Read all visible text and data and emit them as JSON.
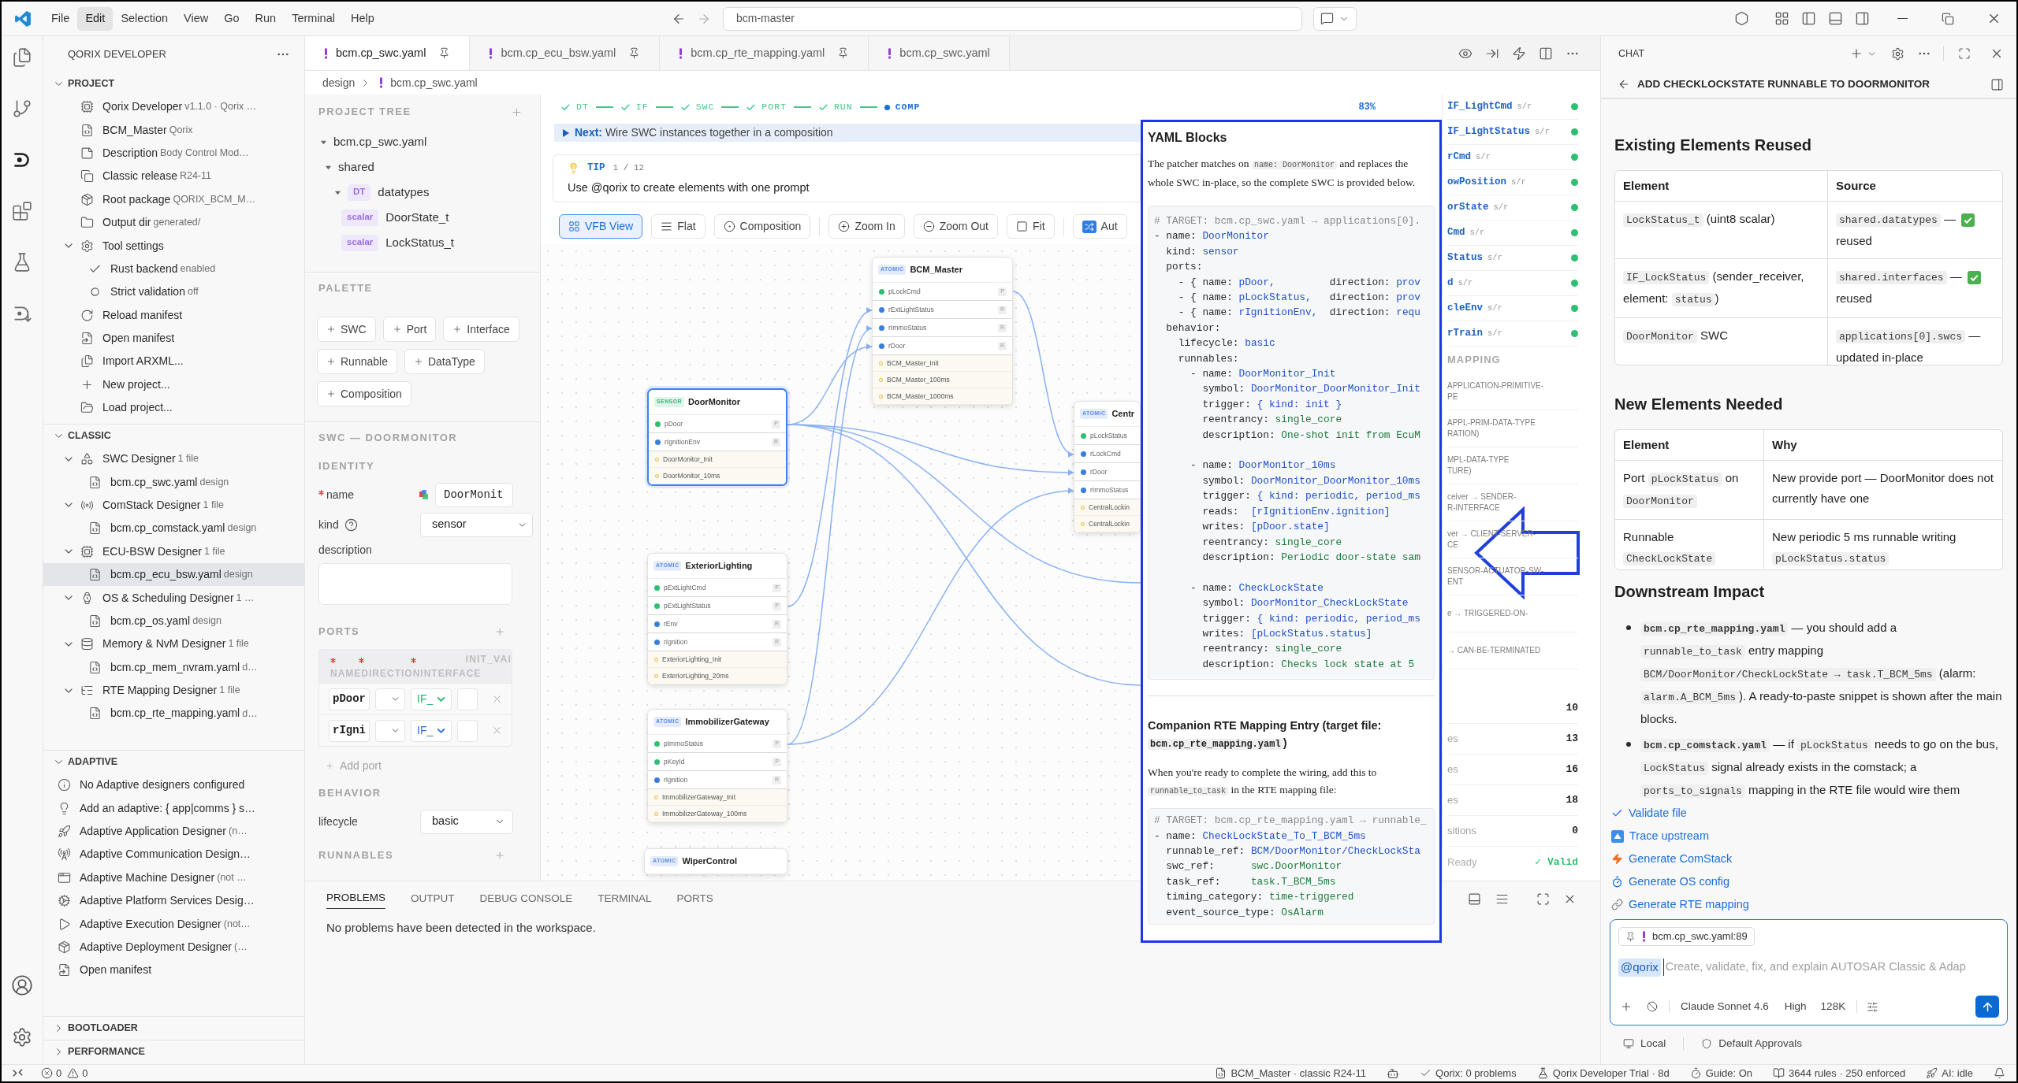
{
  "title_bar": {
    "menu": [
      {
        "label": "File",
        "selected": false
      },
      {
        "label": "Edit",
        "selected": true
      },
      {
        "label": "Selection",
        "selected": false
      },
      {
        "label": "View",
        "selected": false
      },
      {
        "label": "Go",
        "selected": false
      },
      {
        "label": "Run",
        "selected": false
      },
      {
        "label": "Terminal",
        "selected": false
      },
      {
        "label": "Help",
        "selected": false
      }
    ],
    "command_center": "bcm-master"
  },
  "activity_bar": [
    {
      "selected": false
    },
    {
      "selected": false
    },
    {
      "selected": true
    },
    {
      "selected": false
    },
    {
      "selected": false
    },
    {
      "selected": false
    }
  ],
  "sidebar": {
    "title": "QORIX DEVELOPER",
    "sections": [
      {
        "title": "PROJECT",
        "expanded": true,
        "items": [
          {
            "label": "Qorix Developer",
            "detail": "v1.1.0 · Qorix …",
            "selected": false
          },
          {
            "label": "BCM_Master",
            "detail": "Qorix",
            "selected": false
          },
          {
            "label": "Description",
            "detail": "Body Control Mod…",
            "selected": false
          },
          {
            "label": "Classic release",
            "detail": "R24-11",
            "selected": false
          },
          {
            "label": "Root package",
            "detail": "QORIX_BCM_M…",
            "selected": false
          },
          {
            "label": "Output dir",
            "detail": "generated/",
            "selected": false
          },
          {
            "label": "Tool settings",
            "selected": false,
            "expanded": true,
            "children": [
              {
                "label": "Rust backend",
                "detail": "enabled",
                "checked": true,
                "selected": false
              },
              {
                "label": "Strict validation",
                "detail": "off",
                "checked": false,
                "selected": false
              }
            ]
          },
          {
            "label": "Reload manifest",
            "selected": false
          },
          {
            "label": "Open manifest",
            "selected": false
          },
          {
            "label": "Import ARXML...",
            "selected": false
          },
          {
            "label": "New project...",
            "selected": false
          },
          {
            "label": "Load project...",
            "selected": false
          }
        ]
      },
      {
        "title": "CLASSIC",
        "expanded": true,
        "items": [
          {
            "label": "SWC Designer",
            "detail": "1 file",
            "selected": false,
            "expanded": true,
            "children": [
              {
                "label": "bcm.cp_swc.yaml",
                "detail": "design",
                "selected": false
              }
            ]
          },
          {
            "label": "ComStack Designer",
            "detail": "1 file",
            "selected": false,
            "expanded": true,
            "children": [
              {
                "label": "bcm.cp_comstack.yaml",
                "detail": "design",
                "selected": false
              }
            ]
          },
          {
            "label": "ECU-BSW Designer",
            "detail": "1 file",
            "selected": false,
            "expanded": true,
            "children": [
              {
                "label": "bcm.cp_ecu_bsw.yaml",
                "detail": "design",
                "selected": true
              }
            ]
          },
          {
            "label": "OS & Scheduling Designer",
            "detail": "1 …",
            "selected": false,
            "expanded": true,
            "children": [
              {
                "label": "bcm.cp_os.yaml",
                "detail": "design",
                "selected": false
              }
            ]
          },
          {
            "label": "Memory & NvM Designer",
            "detail": "1 file",
            "selected": false,
            "expanded": true,
            "children": [
              {
                "label": "bcm.cp_mem_nvram.yaml",
                "detail": "d…",
                "selected": false
              }
            ]
          },
          {
            "label": "RTE Mapping Designer",
            "detail": "1 file",
            "selected": false,
            "expanded": true,
            "children": [
              {
                "label": "bcm.cp_rte_mapping.yaml",
                "detail": "d…",
                "selected": false
              }
            ]
          }
        ]
      },
      {
        "title": "ADAPTIVE",
        "expanded": true,
        "items": [
          {
            "label": "No Adaptive designers configured",
            "selected": false
          },
          {
            "label": "Add an adaptive: { app|comms } s…",
            "selected": false
          },
          {
            "label": "Adaptive Application Designer",
            "detail": "(n…",
            "selected": false
          },
          {
            "label": "Adaptive Communication Design…",
            "selected": false
          },
          {
            "label": "Adaptive Machine Designer",
            "detail": "(not …",
            "selected": false
          },
          {
            "label": "Adaptive Platform Services Desig…",
            "selected": false
          },
          {
            "label": "Adaptive Execution Designer",
            "detail": "(not…",
            "selected": false
          },
          {
            "label": "Adaptive Deployment Designer",
            "detail": "(…",
            "selected": false
          },
          {
            "label": "Open manifest",
            "selected": false
          }
        ]
      },
      {
        "title": "BOOTLOADER",
        "expanded": false
      },
      {
        "title": "PERFORMANCE",
        "expanded": false
      }
    ]
  },
  "editor": {
    "tabs": [
      {
        "label": "bcm.cp_swc.yaml",
        "selected": true,
        "pinned": true
      },
      {
        "label": "bcm.cp_ecu_bsw.yaml",
        "selected": false,
        "pinned": true
      },
      {
        "label": "bcm.cp_rte_mapping.yaml",
        "selected": false,
        "pinned": true
      },
      {
        "label": "bcm.cp_swc.yaml",
        "selected": false,
        "pinned": false
      }
    ],
    "breadcrumb": [
      "design",
      "bcm.cp_swc.yaml"
    ]
  },
  "project_tree": {
    "title": "PROJECT TREE",
    "items": [
      {
        "label": "bcm.cp_swc.yaml",
        "expanded": true,
        "children": [
          {
            "label": "shared",
            "expanded": true,
            "children": [
              {
                "tag": "DT",
                "label": "datatypes",
                "expanded": true,
                "children": [
                  {
                    "tag": "scalar",
                    "label": "DoorState_t"
                  },
                  {
                    "tag": "scalar",
                    "label": "LockStatus_t"
                  }
                ]
              }
            ]
          }
        ]
      }
    ]
  },
  "palette": {
    "title": "PALETTE",
    "buttons": [
      "SWC",
      "Port",
      "Interface",
      "Runnable",
      "DataType",
      "Composition"
    ]
  },
  "swc_editor": {
    "title": "SWC — DOORMONITOR",
    "identity": {
      "title": "IDENTITY",
      "name": {
        "label": "name",
        "value": "DoorMonit",
        "required": true
      },
      "kind": {
        "label": "kind",
        "value": "sensor"
      },
      "description": {
        "label": "description"
      }
    },
    "ports": {
      "title": "PORTS",
      "header": "NAMEDIRECTIONINTERFACE",
      "extra_column": "INIT_VAI",
      "rows": [
        {
          "name": "pDoor",
          "interface": "IF_",
          "color": "#22b573"
        },
        {
          "name": "rIgni",
          "interface": "IF_",
          "color": "#2f6fe0"
        }
      ],
      "add": "Add port"
    },
    "behavior": {
      "title": "BEHAVIOR",
      "lifecycle": {
        "label": "lifecycle",
        "value": "basic"
      }
    },
    "runnables": {
      "title": "RUNNABLES"
    }
  },
  "canvas": {
    "steps": [
      {
        "label": "DT",
        "done": true
      },
      {
        "label": "IF",
        "done": true
      },
      {
        "label": "SWC",
        "done": true
      },
      {
        "label": "PORT",
        "done": true
      },
      {
        "label": "RUN",
        "done": true
      },
      {
        "label": "COMP",
        "done": false
      }
    ],
    "progress": "83%",
    "next": {
      "label": "Next:",
      "text": "Wire SWC instances together in a composition"
    },
    "tip": {
      "label": "TIP",
      "counter": "1 / 12",
      "text": "Use @qorix to create elements with one prompt"
    },
    "toolbar": [
      {
        "label": "VFB View",
        "selected": true
      },
      {
        "label": "Flat",
        "selected": false
      },
      {
        "label": "Composition",
        "selected": false
      },
      {
        "label": "Zoom In",
        "selected": false
      },
      {
        "label": "Zoom Out",
        "selected": false
      },
      {
        "label": "Fit",
        "selected": false
      },
      {
        "label": "Aut",
        "selected": false
      }
    ],
    "nodes": [
      {
        "kind": "atomic",
        "stereotype": "ATOMIC",
        "name": "BCM_Master",
        "selected": false,
        "ports": [
          {
            "name": "pLockCmd",
            "kind": "provide",
            "badge": "P"
          },
          {
            "name": "rExtLightStatus",
            "kind": "require",
            "badge": "R"
          },
          {
            "name": "rImmoStatus",
            "kind": "require",
            "badge": "R"
          },
          {
            "name": "rDoor",
            "kind": "require",
            "badge": "R"
          }
        ],
        "runnables": [
          "BCM_Master_Init",
          "BCM_Master_100ms",
          "BCM_Master_1000ms"
        ]
      },
      {
        "kind": "sensor",
        "stereotype": "SENSOR",
        "name": "DoorMonitor",
        "selected": true,
        "ports": [
          {
            "name": "pDoor",
            "kind": "provide",
            "badge": "P"
          },
          {
            "name": "rIgnitionEnv",
            "kind": "require",
            "badge": "R"
          }
        ],
        "runnables": [
          "DoorMonitor_Init",
          "DoorMonitor_10ms"
        ]
      },
      {
        "kind": "atomic",
        "stereotype": "ATOMIC",
        "name": "Centr",
        "selected": false,
        "ports": [
          {
            "name": "pLockStatus",
            "kind": "provide"
          },
          {
            "name": "rLockCmd",
            "kind": "require"
          },
          {
            "name": "rDoor",
            "kind": "require"
          },
          {
            "name": "rImmoStatus",
            "kind": "require"
          }
        ],
        "runnables": [
          "CentralLockin",
          "CentralLockin"
        ]
      },
      {
        "kind": "atomic",
        "stereotype": "ATOMIC",
        "name": "ExteriorLighting",
        "selected": false,
        "ports": [
          {
            "name": "pExtLightCmd",
            "kind": "provide",
            "badge": "P"
          },
          {
            "name": "pExtLightStatus",
            "kind": "provide",
            "badge": "P"
          },
          {
            "name": "rEnv",
            "kind": "require",
            "badge": "R"
          },
          {
            "name": "rIgnition",
            "kind": "require",
            "badge": "R"
          }
        ],
        "runnables": [
          "ExteriorLighting_Init",
          "ExteriorLighting_20ms"
        ]
      },
      {
        "kind": "atomic",
        "stereotype": "ATOMIC",
        "name": "ImmobilizerGateway",
        "selected": false,
        "ports": [
          {
            "name": "pImmoStatus",
            "kind": "provide",
            "badge": "P"
          },
          {
            "name": "pKeyId",
            "kind": "provide",
            "badge": "P"
          },
          {
            "name": "rIgnition",
            "kind": "require",
            "badge": "R"
          }
        ],
        "runnables": [
          "ImmobilizerGateway_Init",
          "ImmobilizerGateway_100ms"
        ]
      },
      {
        "kind": "atomic",
        "stereotype": "ATOMIC",
        "name": "WiperControl",
        "selected": false
      }
    ]
  },
  "side_panel": {
    "interfaces": [
      {
        "name": "IF_LightCmd",
        "type": "s/r",
        "color": "#2fbf71"
      },
      {
        "name": "IF_LightStatus",
        "type": "s/r",
        "color": "#2fbf71"
      },
      {
        "name": "rCmd",
        "type": "s/r",
        "color": "#2fbf71"
      },
      {
        "name": "owPosition",
        "type": "s/r",
        "color": "#2fbf71"
      },
      {
        "name": "orState",
        "type": "s/r",
        "color": "#2fbf71"
      },
      {
        "name": "Cmd",
        "type": "s/r",
        "color": "#2fbf71"
      },
      {
        "name": "Status",
        "type": "s/r",
        "color": "#2fbf71"
      },
      {
        "name": "d",
        "type": "s/r",
        "color": "#2fbf71"
      },
      {
        "name": "cleEnv",
        "type": "s/r",
        "color": "#2fbf71"
      },
      {
        "name": "rTrain",
        "type": "s/r",
        "color": "#2fbf71"
      }
    ],
    "mapping": {
      "title": "MAPPING",
      "items": [
        [
          "APPLICATION-PRIMITIVE-",
          "PE"
        ],
        [
          "APPL-PRIM-DATA-TYPE",
          "RATION)"
        ],
        [
          "MPL-DATA-TYPE",
          "TURE)"
        ],
        [
          "ceiver → SENDER-",
          "R-INTERFACE"
        ],
        [
          "ver → CLIENT-SERVER-",
          "CE"
        ],
        [
          "SENSOR-ACTUATOR-SW-",
          "ENT"
        ],
        [
          "e → TRIGGERED-ON-"
        ],
        [
          "→ CAN-BE-TERMINATED"
        ]
      ]
    },
    "stats": [
      {
        "value": "10"
      },
      {
        "label": "es",
        "value": "13"
      },
      {
        "label": "es",
        "value": "16"
      },
      {
        "label": "es",
        "value": "18"
      },
      {
        "label": "sitions",
        "value": "0"
      }
    ],
    "status": {
      "label": "Ready",
      "value": "✓ Valid"
    }
  },
  "yaml_panel": {
    "title": "YAML Blocks",
    "intro": [
      {
        "text": "The patcher matches on ",
        "kind": "text"
      },
      {
        "text": "name: DoorMonitor",
        "kind": "code"
      },
      {
        "text": " and replaces the whole SWC in-place, so the complete SWC is provided below.",
        "kind": "text"
      }
    ],
    "code": [
      {
        "segs": [
          {
            "text": "# TARGET: bcm.cp_swc.yaml → applications[0].",
            "kind": "comment"
          }
        ]
      },
      {
        "segs": [
          {
            "text": "- name: ",
            "kind": "key"
          },
          {
            "text": "DoorMonitor",
            "kind": "name"
          }
        ]
      },
      {
        "segs": [
          {
            "text": "  kind: ",
            "kind": "key"
          },
          {
            "text": "sensor",
            "kind": "name"
          }
        ]
      },
      {
        "segs": [
          {
            "text": "  ports:",
            "kind": "key"
          }
        ]
      },
      {
        "segs": [
          {
            "text": "    - { name: ",
            "kind": "key"
          },
          {
            "text": "pDoor,",
            "kind": "name"
          },
          {
            "text": "         direction: ",
            "kind": "key"
          },
          {
            "text": "prov",
            "kind": "name"
          }
        ]
      },
      {
        "segs": [
          {
            "text": "    - { name: ",
            "kind": "key"
          },
          {
            "text": "pLockStatus,",
            "kind": "name"
          },
          {
            "text": "   direction: ",
            "kind": "key"
          },
          {
            "text": "prov",
            "kind": "name"
          }
        ]
      },
      {
        "segs": [
          {
            "text": "    - { name: ",
            "kind": "key"
          },
          {
            "text": "rIgnitionEnv,",
            "kind": "name"
          },
          {
            "text": "  direction: ",
            "kind": "key"
          },
          {
            "text": "requ",
            "kind": "name"
          }
        ]
      },
      {
        "segs": [
          {
            "text": "  behavior:",
            "kind": "key"
          }
        ]
      },
      {
        "segs": [
          {
            "text": "    lifecycle: ",
            "kind": "key"
          },
          {
            "text": "basic",
            "kind": "name"
          }
        ]
      },
      {
        "segs": [
          {
            "text": "    runnables:",
            "kind": "key"
          }
        ]
      },
      {
        "segs": [
          {
            "text": "      - name: ",
            "kind": "key"
          },
          {
            "text": "DoorMonitor_Init",
            "kind": "name"
          }
        ]
      },
      {
        "segs": [
          {
            "text": "        symbol: ",
            "kind": "key"
          },
          {
            "text": "DoorMonitor_DoorMonitor_Init",
            "kind": "name"
          }
        ]
      },
      {
        "segs": [
          {
            "text": "        trigger: ",
            "kind": "key"
          },
          {
            "text": "{ kind: init }",
            "kind": "name"
          }
        ]
      },
      {
        "segs": [
          {
            "text": "        reentrancy: ",
            "kind": "key"
          },
          {
            "text": "single_core",
            "kind": "string"
          }
        ]
      },
      {
        "segs": [
          {
            "text": "        description: ",
            "kind": "key"
          },
          {
            "text": "One-shot init from EcuM",
            "kind": "string"
          }
        ]
      },
      {
        "gap": true,
        "segs": [
          {
            "text": "      - name: ",
            "kind": "key"
          },
          {
            "text": "DoorMonitor_10ms",
            "kind": "name"
          }
        ]
      },
      {
        "segs": [
          {
            "text": "        symbol: ",
            "kind": "key"
          },
          {
            "text": "DoorMonitor_DoorMonitor_10ms",
            "kind": "name"
          }
        ]
      },
      {
        "segs": [
          {
            "text": "        trigger: ",
            "kind": "key"
          },
          {
            "text": "{ kind: periodic, period_ms",
            "kind": "name"
          }
        ]
      },
      {
        "segs": [
          {
            "text": "        reads:  ",
            "kind": "key"
          },
          {
            "text": "[rIgnitionEnv.ignition]",
            "kind": "name"
          }
        ]
      },
      {
        "segs": [
          {
            "text": "        writes: ",
            "kind": "key"
          },
          {
            "text": "[pDoor.state]",
            "kind": "name"
          }
        ]
      },
      {
        "segs": [
          {
            "text": "        reentrancy: ",
            "kind": "key"
          },
          {
            "text": "single_core",
            "kind": "string"
          }
        ]
      },
      {
        "segs": [
          {
            "text": "        description: ",
            "kind": "key"
          },
          {
            "text": "Periodic door-state sam",
            "kind": "string"
          }
        ]
      },
      {
        "gap": true,
        "segs": [
          {
            "text": "      - name: ",
            "kind": "key"
          },
          {
            "text": "CheckLockState",
            "kind": "name"
          }
        ]
      },
      {
        "segs": [
          {
            "text": "        symbol: ",
            "kind": "key"
          },
          {
            "text": "DoorMonitor_CheckLockState",
            "kind": "name"
          }
        ]
      },
      {
        "segs": [
          {
            "text": "        trigger: ",
            "kind": "key"
          },
          {
            "text": "{ kind: periodic, period_ms",
            "kind": "name"
          }
        ]
      },
      {
        "segs": [
          {
            "text": "        writes: ",
            "kind": "key"
          },
          {
            "text": "[pLockStatus.status]",
            "kind": "name"
          }
        ]
      },
      {
        "segs": [
          {
            "text": "        reentrancy: ",
            "kind": "key"
          },
          {
            "text": "single_core",
            "kind": "string"
          }
        ]
      },
      {
        "segs": [
          {
            "text": "        description: ",
            "kind": "key"
          },
          {
            "text": "Checks lock state at 5",
            "kind": "string"
          }
        ]
      }
    ],
    "companion_title": [
      {
        "text": "Companion RTE Mapping Entry (target file: ",
        "kind": "text"
      },
      {
        "text": "bcm.cp_rte_mapping.yaml",
        "kind": "code"
      },
      {
        "text": ")",
        "kind": "text"
      }
    ],
    "companion_intro": [
      {
        "text": "When you're ready to complete the wiring, add this to ",
        "kind": "text"
      },
      {
        "text": "runnable_to_task",
        "kind": "code"
      },
      {
        "text": " in the RTE mapping file:",
        "kind": "text"
      }
    ],
    "companion_code": [
      {
        "segs": [
          {
            "text": "# TARGET: bcm.cp_rte_mapping.yaml → runnable_",
            "kind": "comment"
          }
        ]
      },
      {
        "segs": [
          {
            "text": "- name: ",
            "kind": "key"
          },
          {
            "text": "CheckLockState_To_T_BCM_5ms",
            "kind": "name"
          }
        ]
      },
      {
        "segs": [
          {
            "text": "  runnable_ref: ",
            "kind": "key"
          },
          {
            "text": "BCM/DoorMonitor/CheckLockSta",
            "kind": "name"
          }
        ]
      },
      {
        "segs": [
          {
            "text": "  swc_ref:      ",
            "kind": "key"
          },
          {
            "text": "swc.DoorMonitor",
            "kind": "string"
          }
        ]
      },
      {
        "segs": [
          {
            "text": "  task_ref:     ",
            "kind": "key"
          },
          {
            "text": "task.T_BCM_5ms",
            "kind": "string"
          }
        ]
      },
      {
        "segs": [
          {
            "text": "  timing_category: ",
            "kind": "key"
          },
          {
            "text": "time-triggered",
            "kind": "string"
          }
        ]
      },
      {
        "segs": [
          {
            "text": "  event_source_type: ",
            "kind": "key"
          },
          {
            "text": "OsAlarm",
            "kind": "string"
          }
        ]
      }
    ]
  },
  "panel": {
    "tabs": [
      {
        "label": "PROBLEMS",
        "selected": true
      },
      {
        "label": "OUTPUT",
        "selected": false
      },
      {
        "label": "DEBUG CONSOLE",
        "selected": false
      },
      {
        "label": "TERMINAL",
        "selected": false
      },
      {
        "label": "PORTS",
        "selected": false
      }
    ],
    "message": "No problems have been detected in the workspace."
  },
  "chat": {
    "header": "CHAT",
    "title": "ADD CHECKLOCKSTATE RUNNABLE TO DOORMONITOR",
    "blocks": [
      {
        "kind": "heading",
        "text": "Existing Elements Reused"
      },
      {
        "kind": "table",
        "columns": [
          "Element",
          "Source"
        ],
        "rows": [
          {
            "cells": [
              {
                "parts": [
                  {
                    "text": "LockStatus_t",
                    "kind": "code"
                  },
                  {
                    "text": " (uint8 scalar)",
                    "kind": "text"
                  }
                ]
              },
              {
                "parts": [
                  {
                    "text": "shared.datatypes",
                    "kind": "code"
                  },
                  {
                    "text": " —",
                    "kind": "text"
                  }
                ],
                "checked": true,
                "note": "reused"
              }
            ]
          },
          {
            "cells": [
              {
                "parts": [
                  {
                    "text": "IF_LockStatus",
                    "kind": "code"
                  },
                  {
                    "text": " (sender_receiver, element: ",
                    "kind": "text"
                  },
                  {
                    "text": "status",
                    "kind": "code"
                  },
                  {
                    "text": ")",
                    "kind": "text"
                  }
                ]
              },
              {
                "parts": [
                  {
                    "text": "shared.interfaces",
                    "kind": "code"
                  },
                  {
                    "text": " —",
                    "kind": "text"
                  }
                ],
                "checked": true,
                "note": "reused"
              }
            ]
          },
          {
            "cells": [
              {
                "parts": [
                  {
                    "text": "DoorMonitor",
                    "kind": "code"
                  },
                  {
                    "text": " SWC",
                    "kind": "text"
                  }
                ]
              },
              {
                "parts": [
                  {
                    "text": "applications[0].swcs",
                    "kind": "code"
                  },
                  {
                    "text": " —",
                    "kind": "text"
                  }
                ],
                "checked": false,
                "note": "updated in-place"
              }
            ]
          }
        ]
      },
      {
        "kind": "heading",
        "text": "New Elements Needed"
      },
      {
        "kind": "table",
        "columns": [
          "Element",
          "Why"
        ],
        "rows": [
          {
            "cells": [
              {
                "parts": [
                  {
                    "text": "Port ",
                    "kind": "text"
                  },
                  {
                    "text": "pLockStatus",
                    "kind": "code"
                  },
                  {
                    "text": " on ",
                    "kind": "text"
                  },
                  {
                    "text": "DoorMonitor",
                    "kind": "code"
                  }
                ]
              },
              {
                "parts": [
                  {
                    "text": "New provide port — DoorMonitor does not currently have one",
                    "kind": "text"
                  }
                ]
              }
            ]
          },
          {
            "cells": [
              {
                "parts": [
                  {
                    "text": "Runnable ",
                    "kind": "text"
                  },
                  {
                    "text": "CheckLockState",
                    "kind": "code"
                  }
                ]
              },
              {
                "parts": [
                  {
                    "text": "New periodic 5 ms runnable writing ",
                    "kind": "text"
                  },
                  {
                    "text": "pLockStatus.status",
                    "kind": "code"
                  }
                ]
              }
            ]
          }
        ]
      },
      {
        "kind": "heading",
        "text": "Downstream Impact"
      },
      {
        "kind": "bullets",
        "items": [
          {
            "parts": [
              {
                "text": "bcm.cp_rte_mapping.yaml",
                "kind": "strong_code"
              },
              {
                "text": " — you should add a ",
                "kind": "text"
              },
              {
                "text": "runnable_to_task",
                "kind": "code"
              },
              {
                "text": " entry mapping ",
                "kind": "text"
              },
              {
                "text": "BCM/DoorMonitor/CheckLockState → task.T_BCM_5ms",
                "kind": "code"
              },
              {
                "text": " (alarm: ",
                "kind": "text"
              },
              {
                "text": "alarm.A_BCM_5ms",
                "kind": "code"
              },
              {
                "text": "). A ready-to-paste snippet is shown after the main blocks.",
                "kind": "text"
              }
            ]
          },
          {
            "parts": [
              {
                "text": "bcm.cp_comstack.yaml",
                "kind": "strong_code"
              },
              {
                "text": " — if ",
                "kind": "text"
              },
              {
                "text": "pLockStatus",
                "kind": "code"
              },
              {
                "text": " needs to go on the bus, ",
                "kind": "text"
              },
              {
                "text": "LockStatus",
                "kind": "code"
              },
              {
                "text": " signal already exists in the comstack; a ",
                "kind": "text"
              },
              {
                "text": "ports_to_signals",
                "kind": "code"
              },
              {
                "text": " mapping in the RTE file would wire them",
                "kind": "text"
              }
            ]
          }
        ]
      }
    ],
    "actions": [
      "Validate file",
      "Trace upstream",
      "Generate ComStack",
      "Generate OS config",
      "Generate RTE mapping"
    ],
    "composer": {
      "context_file": "bcm.cp_swc.yaml:89",
      "mention": "@qorix",
      "placeholder": "Create, validate, fix, and explain AUTOSAR Classic & Adap",
      "model": "Claude Sonnet 4.6",
      "effort": "High",
      "context_size": "128K"
    },
    "footer": [
      "Local",
      "Default Approvals"
    ]
  },
  "status_bar": {
    "errors": "0",
    "warnings": "0",
    "items": [
      "BCM_Master · classic R24-11",
      "Qorix: 0 problems",
      "Qorix Developer Trial · 8d",
      "Guide: On",
      "3644 rules · 250 enforced",
      "AI: idle"
    ]
  }
}
